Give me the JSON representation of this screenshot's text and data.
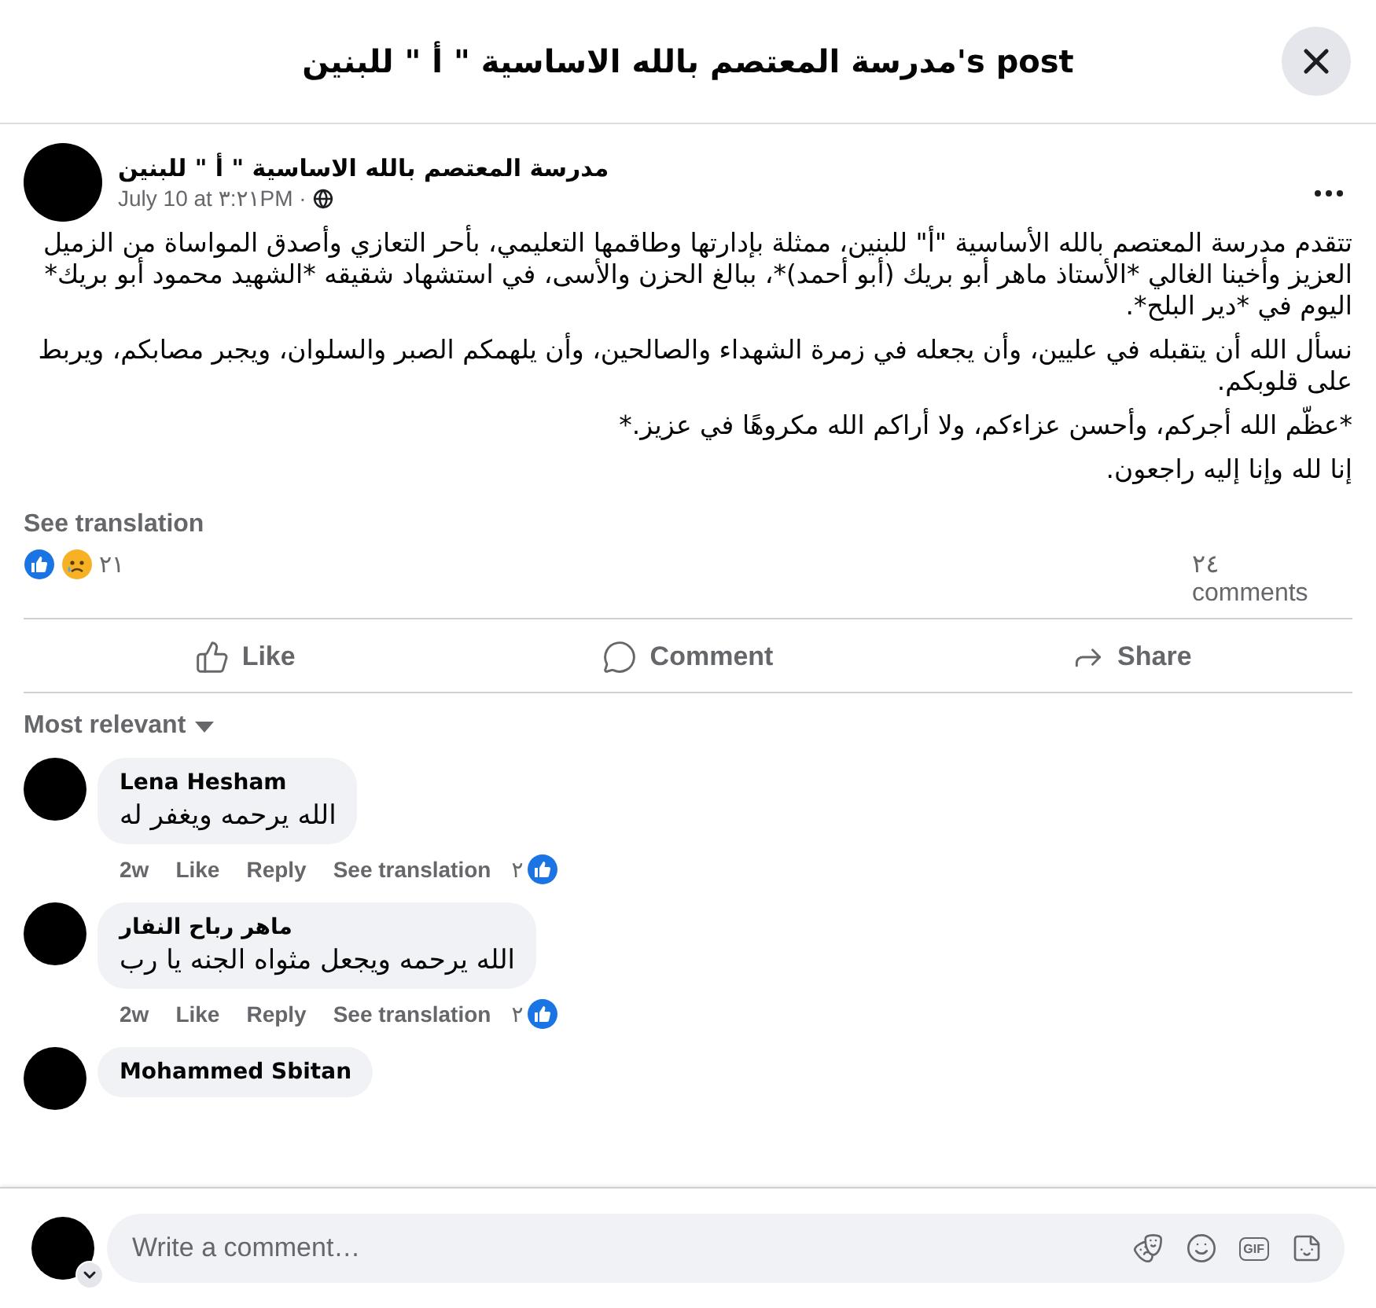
{
  "header": {
    "title": "مدرسة المعتصم بالله الاساسية \" أ \" للبنين's post"
  },
  "post": {
    "author": "مدرسة المعتصم بالله الاساسية \" أ \" للبنين",
    "time": "July 10 at ٣:٢١PM ·",
    "paragraphs": [
      "تتقدم مدرسة المعتصم بالله الأساسية \"أ\" للبنين، ممثلة بإدارتها وطاقمها التعليمي، بأحر التعازي وأصدق المواساة من الزميل العزيز وأخينا الغالي *الأستاذ ماهر أبو بريك (أبو أحمد)*، ببالغ الحزن والأسى، في استشهاد شقيقه *الشهيد محمود أبو بريك* اليوم في *دير البلح*.",
      "نسأل الله أن يتقبله في عليين، وأن يجعله في زمرة الشهداء والصالحين، وأن يلهمكم الصبر والسلوان، ويجبر مصابكم، ويربط على قلوبكم.",
      "*عظّم الله أجركم، وأحسن عزاءكم، ولا أراكم الله مكروهًا في عزيز.*",
      "إنا لله وإنا إليه راجعون."
    ],
    "see_translation": "See translation",
    "reaction_count": "٢١",
    "comment_count": "٢٤ comments"
  },
  "actions": {
    "like": "Like",
    "comment": "Comment",
    "share": "Share"
  },
  "sort": {
    "label": "Most relevant"
  },
  "comments": [
    {
      "author": "Lena Hesham",
      "text": "الله يرحمه ويغفر له",
      "time": "2w",
      "like_link": "Like",
      "reply_link": "Reply",
      "translate_link": "See translation",
      "likes": "٢"
    },
    {
      "author": "ماهر رباح النفار",
      "text": "الله يرحمه ويجعل مثواه الجنه يا رب",
      "time": "2w",
      "like_link": "Like",
      "reply_link": "Reply",
      "translate_link": "See translation",
      "likes": "٢"
    },
    {
      "author": "Mohammed Sbitan"
    }
  ],
  "composer": {
    "placeholder": "Write a comment…",
    "gif_label": "GIF"
  }
}
